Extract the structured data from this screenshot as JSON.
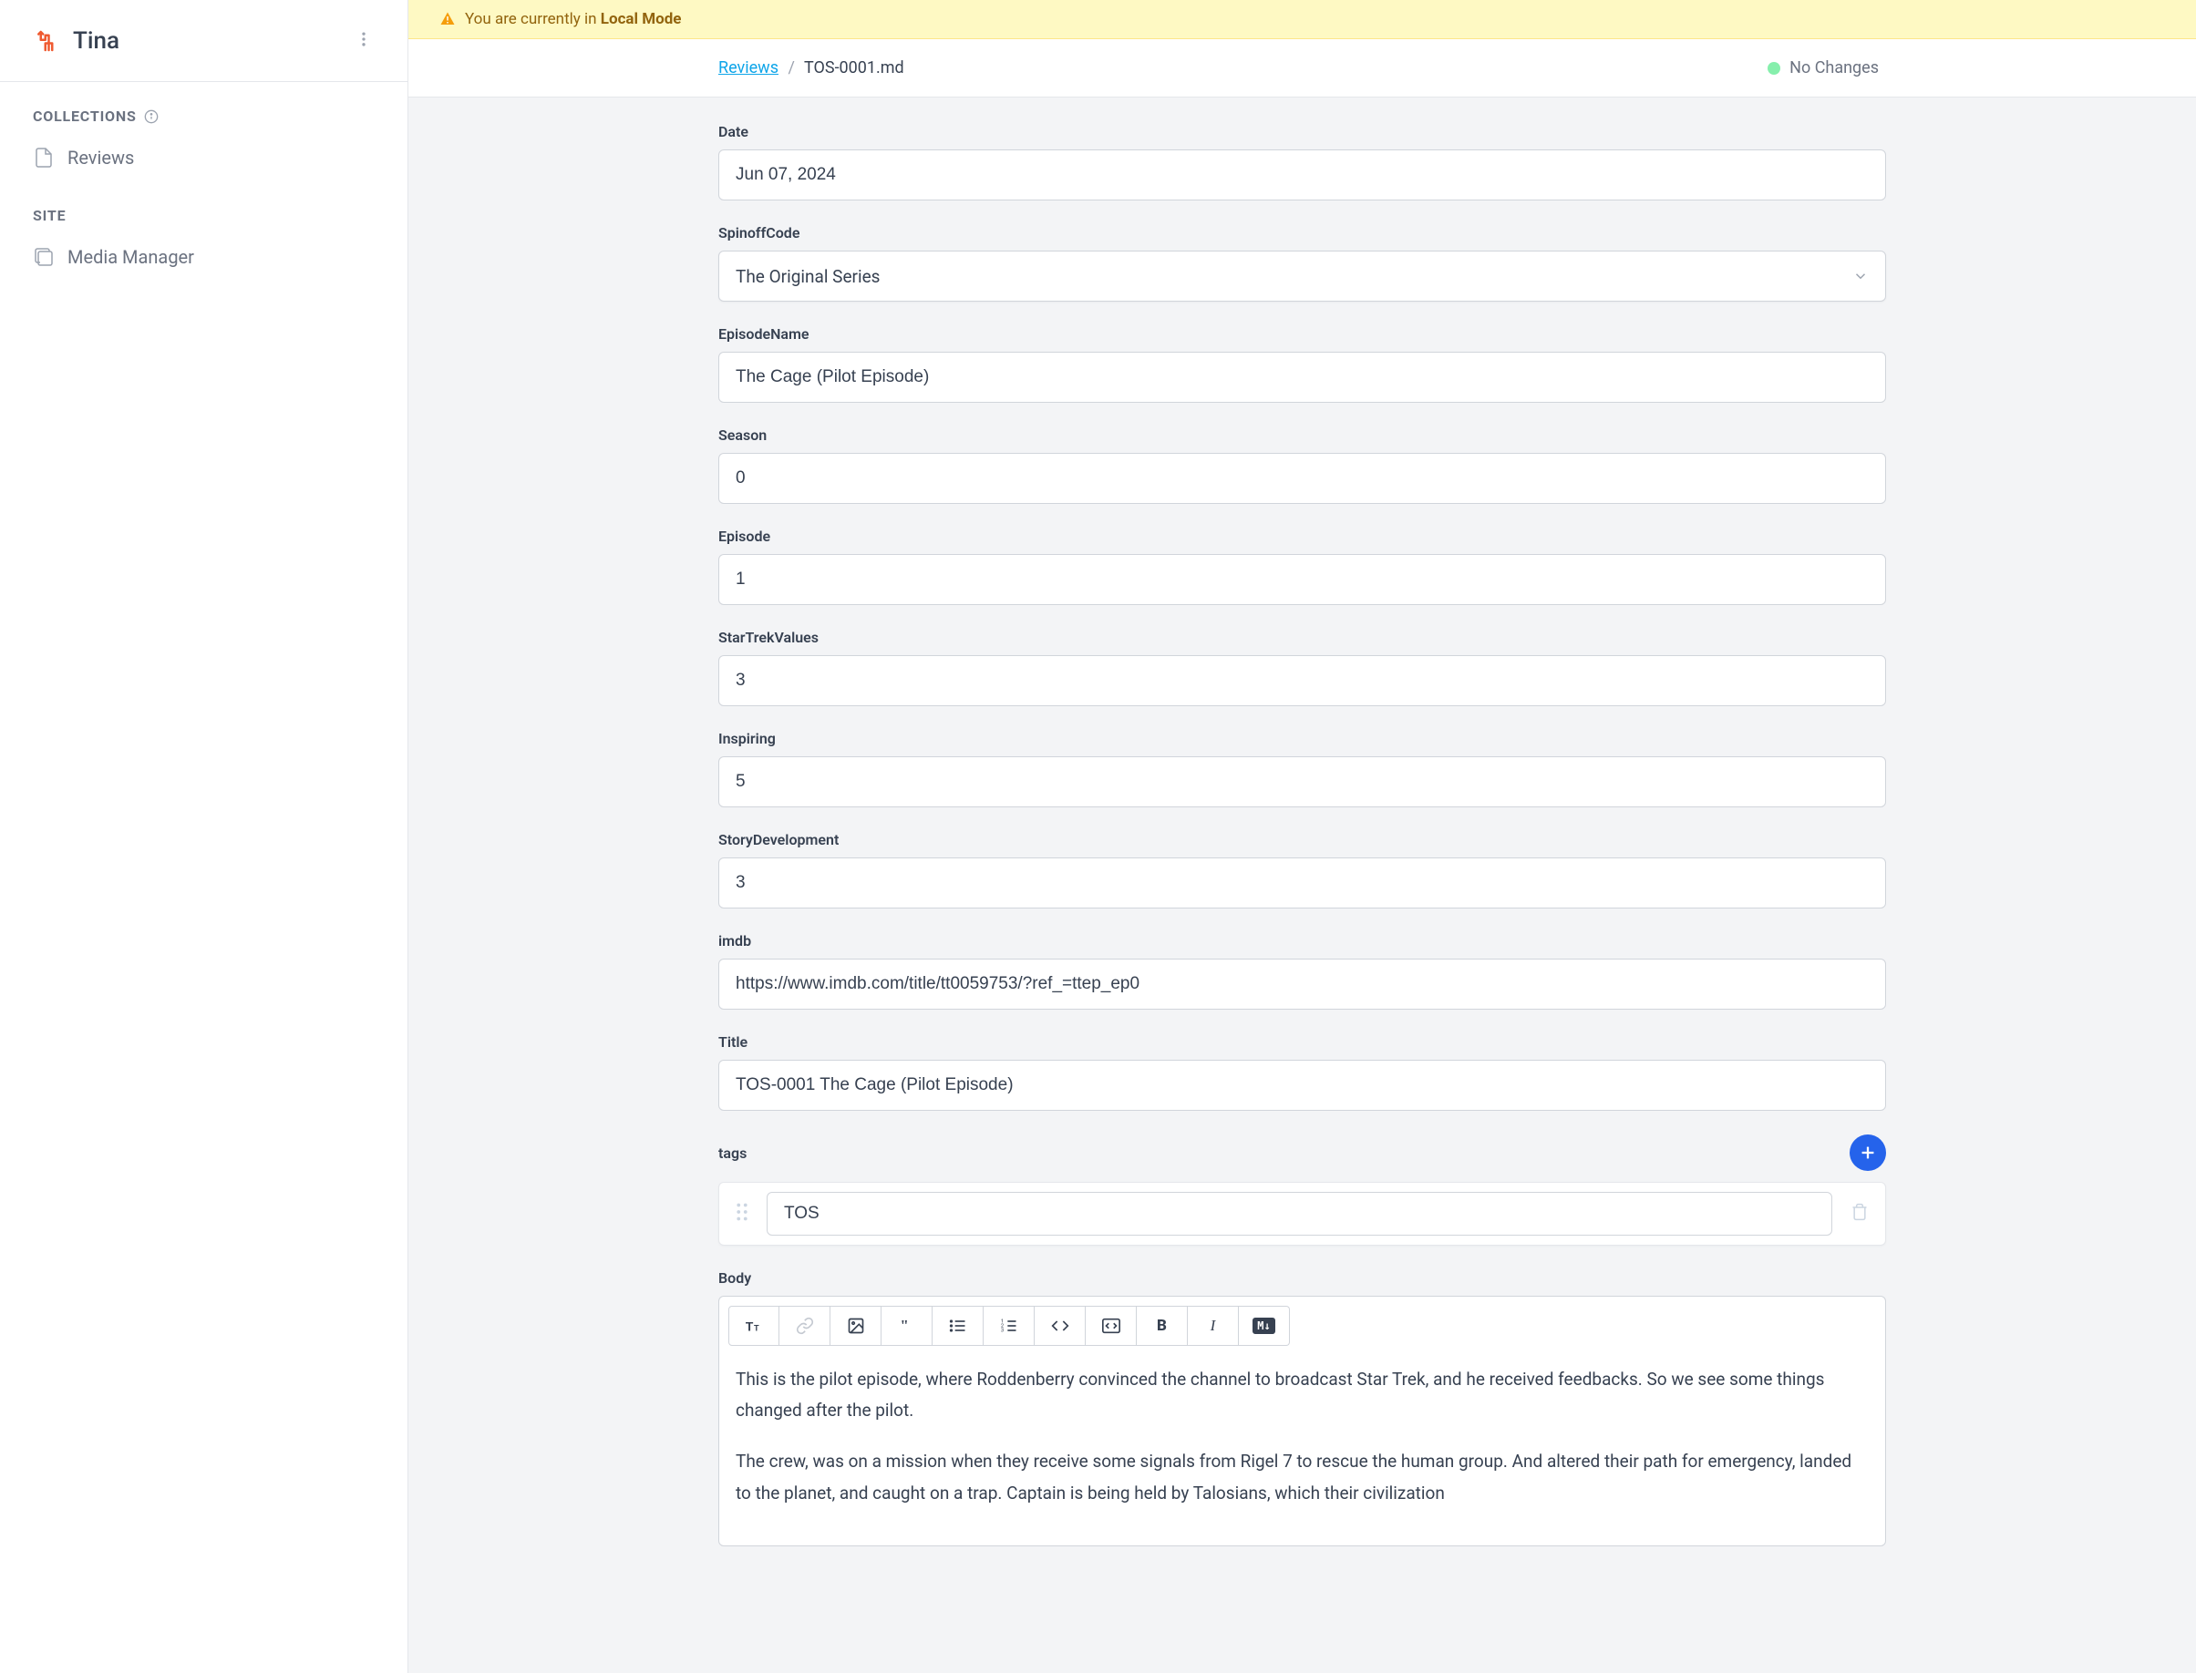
{
  "brand": {
    "name": "Tina"
  },
  "sidebar": {
    "sections": {
      "collections": {
        "title": "COLLECTIONS"
      },
      "site": {
        "title": "SITE"
      }
    },
    "items": {
      "reviews": {
        "label": "Reviews"
      },
      "media": {
        "label": "Media Manager"
      }
    }
  },
  "notice": {
    "prefix": "You are currently in ",
    "mode": "Local Mode"
  },
  "breadcrumb": {
    "root": "Reviews",
    "current": "TOS-0001.md"
  },
  "status": {
    "label": "No Changes"
  },
  "fields": {
    "date": {
      "label": "Date",
      "value": "Jun 07, 2024"
    },
    "spinoffCode": {
      "label": "SpinoffCode",
      "value": "The Original Series"
    },
    "episodeName": {
      "label": "EpisodeName",
      "value": "The Cage (Pilot Episode)"
    },
    "season": {
      "label": "Season",
      "value": "0"
    },
    "episode": {
      "label": "Episode",
      "value": "1"
    },
    "starTrekValues": {
      "label": "StarTrekValues",
      "value": "3"
    },
    "inspiring": {
      "label": "Inspiring",
      "value": "5"
    },
    "storyDevelopment": {
      "label": "StoryDevelopment",
      "value": "3"
    },
    "imdb": {
      "label": "imdb",
      "value": "https://www.imdb.com/title/tt0059753/?ref_=ttep_ep0"
    },
    "title": {
      "label": "Title",
      "value": "TOS-0001 The Cage (Pilot Episode)"
    },
    "tags": {
      "label": "tags",
      "items": [
        "TOS"
      ]
    },
    "body": {
      "label": "Body",
      "paragraphs": [
        "This is the pilot episode, where Roddenberry convinced the channel to broadcast Star Trek, and he received feedbacks. So we see some things changed after the pilot.",
        "The crew, was on a mission when they receive some signals from Rigel 7 to rescue the human group. And altered their path for emergency, landed to the planet, and caught on a trap. Captain is being held by Talosians, which their civilization"
      ]
    }
  },
  "toolbar": {
    "markdown": "M↓"
  }
}
